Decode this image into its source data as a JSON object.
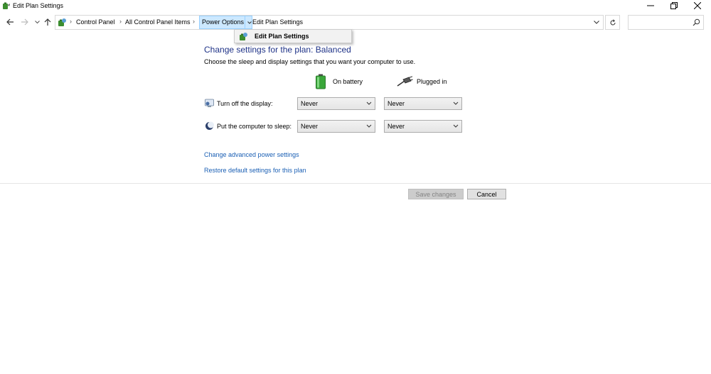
{
  "window": {
    "title": "Edit Plan Settings"
  },
  "address": {
    "crumbs": [
      "Control Panel",
      "All Control Panel Items",
      "Power Options",
      "Edit Plan Settings"
    ],
    "search_placeholder": ""
  },
  "crumb_menu": {
    "item": "Edit Plan Settings"
  },
  "content": {
    "heading": "Change settings for the plan: Balanced",
    "subtext": "Choose the sleep and display settings that you want your computer to use.",
    "columns": {
      "battery": "On battery",
      "plugged": "Plugged in"
    },
    "rows": [
      {
        "label": "Turn off the display:",
        "battery": "Never",
        "plugged": "Never"
      },
      {
        "label": "Put the computer to sleep:",
        "battery": "Never",
        "plugged": "Never"
      }
    ],
    "links": {
      "advanced": "Change advanced power settings",
      "restore": "Restore default settings for this plan"
    }
  },
  "buttons": {
    "save": "Save changes",
    "cancel": "Cancel"
  },
  "colors": {
    "heading": "#1e3287",
    "link": "#1a5fb4",
    "crumb_highlight": "#cce8ff"
  },
  "icons": {
    "app": "power-options-icon",
    "battery": "battery-icon",
    "plug": "plug-icon",
    "display": "monitor-icon",
    "sleep": "moon-icon"
  }
}
